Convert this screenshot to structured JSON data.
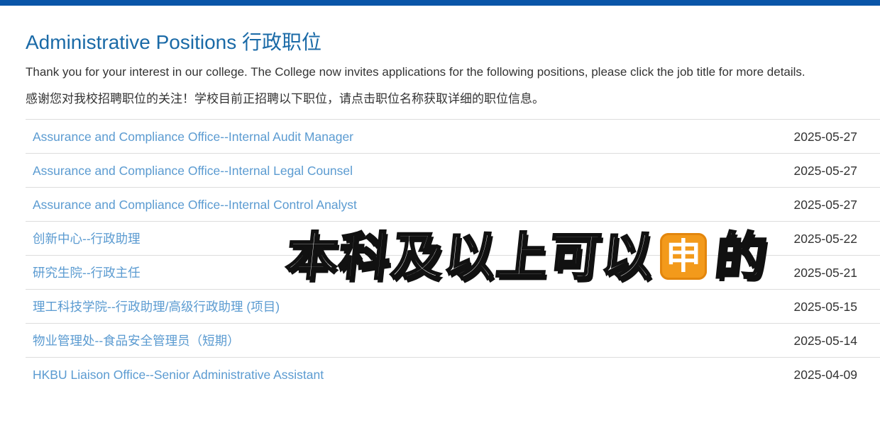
{
  "page": {
    "title": "Administrative Positions 行政职位",
    "intro_en": "Thank you for your interest in our college. The College now invites applications for the following positions, please click the job title for more details.",
    "intro_zh": "感谢您对我校招聘职位的关注！学校目前正招聘以下职位，请点击职位名称获取详细的职位信息。"
  },
  "jobs": [
    {
      "title": "Assurance and Compliance Office--Internal Audit Manager",
      "date": "2025-05-27"
    },
    {
      "title": "Assurance and Compliance Office--Internal Legal Counsel",
      "date": "2025-05-27"
    },
    {
      "title": "Assurance and Compliance Office--Internal Control Analyst",
      "date": "2025-05-27"
    },
    {
      "title": "创新中心--行政助理",
      "date": "2025-05-22"
    },
    {
      "title": "研究生院--行政主任",
      "date": "2025-05-21"
    },
    {
      "title": "理工科技学院--行政助理/高级行政助理 (项目)",
      "date": "2025-05-15"
    },
    {
      "title": "物业管理处--食品安全管理员（短期）",
      "date": "2025-05-14"
    },
    {
      "title": "HKBU Liaison Office--Senior Administrative Assistant",
      "date": "2025-04-09"
    }
  ],
  "overlay": {
    "text_before": "本科及以上可以",
    "badge_char": "申",
    "text_after": "的",
    "badge_color": "#f39a1b"
  },
  "colors": {
    "top_bar": "#0a55a8",
    "title": "#1a6aa7",
    "link": "#5b9bd1"
  }
}
